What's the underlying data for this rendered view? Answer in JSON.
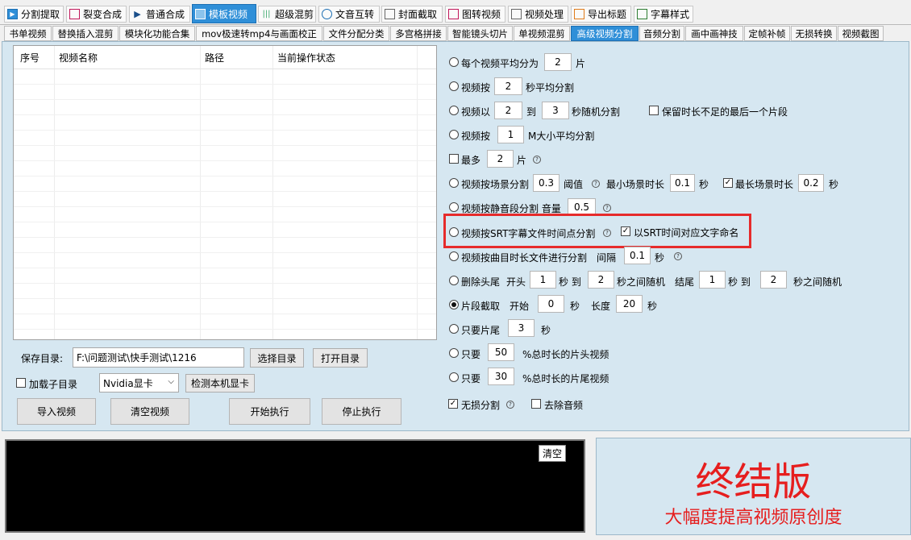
{
  "top_tabs": [
    {
      "label": "分割提取",
      "icon": "split-icon"
    },
    {
      "label": "裂变合成",
      "icon": "merge-icon"
    },
    {
      "label": "普通合成",
      "icon": "play-icon"
    },
    {
      "label": "模板视频",
      "icon": "template-icon"
    },
    {
      "label": "超级混剪",
      "icon": "waveform-icon"
    },
    {
      "label": "文音互转",
      "icon": "microphone-icon"
    },
    {
      "label": "封面截取",
      "icon": "picture-icon"
    },
    {
      "label": "图转视频",
      "icon": "image-to-video-icon"
    },
    {
      "label": "视频处理",
      "icon": "video-process-icon"
    },
    {
      "label": "导出标题",
      "icon": "export-icon"
    },
    {
      "label": "字幕样式",
      "icon": "subtitle-icon"
    }
  ],
  "sub_tabs": [
    "书单视频",
    "替换插入混剪",
    "模块化功能合集",
    "mov极速转mp4与画面校正",
    "文件分配分类",
    "多宫格拼接",
    "智能镜头切片",
    "单视频混剪",
    "高级视频分割",
    "音频分割",
    "画中画神技",
    "定帧补帧",
    "无损转换",
    "视频截图"
  ],
  "grid": {
    "columns": [
      "序号",
      "视频名称",
      "路径",
      "当前操作状态"
    ]
  },
  "left": {
    "save_dir_label": "保存目录:",
    "save_dir_value": "F:\\问题测试\\快手测试\\1216",
    "choose_dir": "选择目录",
    "open_dir": "打开目录",
    "load_subdir": "加载子目录",
    "gpu_select": "Nvidia显卡",
    "detect_gpu": "检测本机显卡",
    "import_video": "导入视频",
    "clear_video": "清空视频",
    "start": "开始执行",
    "stop": "停止执行"
  },
  "options": {
    "o1": {
      "a": "每个视频平均分为",
      "v": "2",
      "b": "片"
    },
    "o2": {
      "a": "视频按",
      "v": "2",
      "b": "秒平均分割"
    },
    "o3": {
      "a": "视频以",
      "v1": "2",
      "mid": "到",
      "v2": "3",
      "b": "秒随机分割",
      "keep": "保留时长不足的最后一个片段"
    },
    "o4": {
      "a": "视频按",
      "v": "1",
      "b": "M大小平均分割"
    },
    "o5": {
      "a": "最多",
      "v": "2",
      "b": "片"
    },
    "o6": {
      "a": "视频按场景分割",
      "v": "0.3",
      "b": "阈值",
      "c": "最小场景时长",
      "v2": "0.1",
      "d": "秒",
      "e": "最长场景时长",
      "v3": "0.2",
      "f": "秒"
    },
    "o7": {
      "a": "视频按静音段分割 音量",
      "v": "0.5"
    },
    "o8": {
      "a": "视频按SRT字幕文件时间点分割",
      "b": "以SRT时间对应文字命名"
    },
    "o9": {
      "a": "视频按曲目时长文件进行分割",
      "b": "间隔",
      "v": "0.1",
      "c": "秒"
    },
    "o10": {
      "a": "删除头尾",
      "b": "开头",
      "v1": "1",
      "c": "秒 到",
      "v2": "2",
      "d": "秒之间随机",
      "e": "结尾",
      "v3": "1",
      "f": "秒 到",
      "v4": "2",
      "g": "秒之间随机"
    },
    "o11": {
      "a": "片段截取",
      "b": "开始",
      "v1": "0",
      "c": "秒",
      "d": "长度",
      "v2": "20",
      "e": "秒"
    },
    "o12": {
      "a": "只要片尾",
      "v": "3",
      "b": "秒"
    },
    "o13": {
      "a": "只要",
      "v": "50",
      "b": "%总时长的片头视频"
    },
    "o14": {
      "a": "只要",
      "v": "30",
      "b": "%总时长的片尾视频"
    },
    "lossless": "无损分割",
    "remove_audio": "去除音频"
  },
  "log": {
    "clear": "清空"
  },
  "promo": {
    "title": "终结版",
    "subtitle": "大幅度提高视频原创度"
  },
  "colors": {
    "accent": "#2f8fd8",
    "panel": "#d6e7f1",
    "highlight": "#e62b2b",
    "promo_text": "#e61e1e"
  }
}
